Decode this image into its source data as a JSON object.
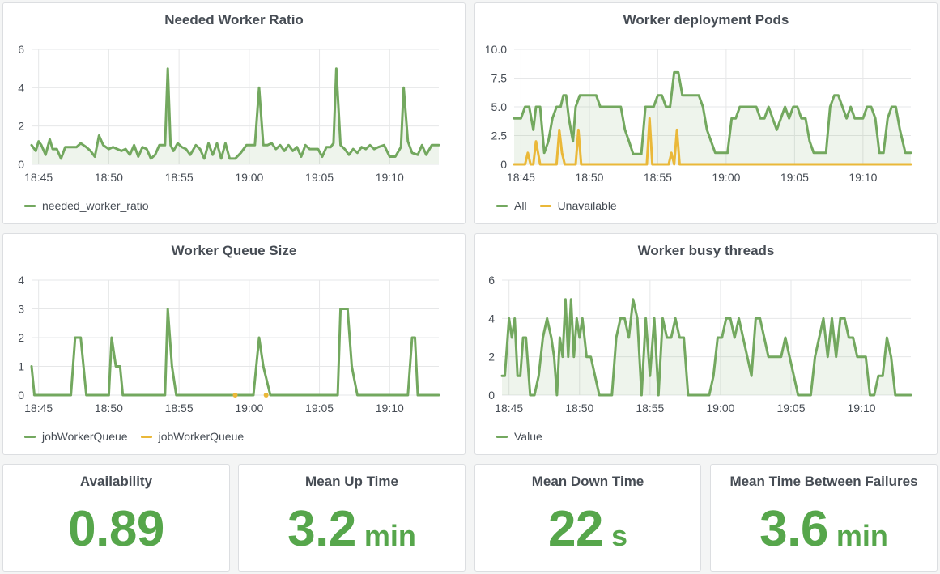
{
  "colors": {
    "green": "#73a85f",
    "green_fill": "rgba(115,168,95,0.12)",
    "yellow": "#eab839",
    "stat_green": "#56a64b",
    "grid": "#e6e7e8",
    "axis_text": "#464c54"
  },
  "panels": {
    "needed_ratio": {
      "title": "Needed Worker Ratio"
    },
    "deploy_pods": {
      "title": "Worker deployment Pods"
    },
    "queue_size": {
      "title": "Worker Queue Size"
    },
    "busy_threads": {
      "title": "Worker busy threads"
    }
  },
  "stats": [
    {
      "title": "Availability",
      "value": "0.89",
      "unit": ""
    },
    {
      "title": "Mean Up Time",
      "value": "3.2",
      "unit": "min"
    },
    {
      "title": "Mean Down Time",
      "value": "22",
      "unit": "s"
    },
    {
      "title": "Mean Time Between Failures",
      "value": "3.6",
      "unit": "min"
    }
  ],
  "chart_data": [
    {
      "type": "area",
      "title": "Needed Worker Ratio",
      "x_ticks": [
        "18:45",
        "18:50",
        "18:55",
        "19:00",
        "19:05",
        "19:10"
      ],
      "x_range_min": [
        -0.5,
        28.5
      ],
      "y_ticks": [
        "0",
        "2",
        "4",
        "6"
      ],
      "ylim": [
        0,
        6
      ],
      "legend_position": "bottom-left",
      "series": [
        {
          "name": "needed_worker_ratio",
          "color": "#73a85f",
          "fill": true,
          "x": [
            -0.5,
            -0.2,
            0,
            0.2,
            0.5,
            0.8,
            1,
            1.3,
            1.6,
            1.9,
            2.3,
            2.7,
            3,
            3.4,
            3.7,
            4,
            4.3,
            4.6,
            5,
            5.3,
            5.6,
            5.9,
            6.2,
            6.5,
            6.8,
            7.1,
            7.4,
            7.7,
            8,
            8.3,
            8.6,
            9,
            9.2,
            9.4,
            9.6,
            9.9,
            10.2,
            10.5,
            10.8,
            11.2,
            11.5,
            11.8,
            12.1,
            12.4,
            12.7,
            13,
            13.3,
            13.6,
            14,
            14.4,
            14.8,
            15.1,
            15.4,
            15.7,
            16,
            16.3,
            16.6,
            16.9,
            17.2,
            17.5,
            17.8,
            18.1,
            18.4,
            18.7,
            19,
            19.3,
            19.6,
            19.9,
            20.2,
            20.5,
            20.8,
            21,
            21.2,
            21.5,
            21.8,
            22.1,
            22.4,
            22.7,
            23,
            23.3,
            23.6,
            23.9,
            24.2,
            24.6,
            25,
            25.4,
            25.8,
            26,
            26.3,
            26.6,
            27,
            27.3,
            27.6,
            28,
            28.5
          ],
          "y": [
            1,
            0.7,
            1.2,
            1,
            0.5,
            1.3,
            0.8,
            0.8,
            0.3,
            0.9,
            0.9,
            0.9,
            1.1,
            0.9,
            0.7,
            0.4,
            1.5,
            1,
            0.8,
            0.9,
            0.8,
            0.7,
            0.8,
            0.5,
            1,
            0.4,
            0.9,
            0.8,
            0.3,
            0.5,
            1,
            1,
            5,
            1,
            0.7,
            1.1,
            0.9,
            0.8,
            0.5,
            1,
            0.8,
            0.3,
            1.1,
            0.5,
            1.1,
            0.3,
            1.1,
            0.3,
            0.3,
            0.6,
            1,
            1,
            1,
            4,
            1,
            1,
            1.1,
            0.8,
            1,
            0.7,
            1,
            0.7,
            0.9,
            0.4,
            1,
            0.8,
            0.8,
            0.8,
            0.4,
            0.9,
            0.9,
            1.1,
            5,
            1,
            0.8,
            0.5,
            0.8,
            0.6,
            0.9,
            0.8,
            1,
            0.8,
            0.9,
            1,
            0.4,
            0.4,
            0.9,
            4,
            1.2,
            0.6,
            0.5,
            1,
            0.5,
            1,
            1
          ]
        }
      ]
    },
    {
      "type": "area",
      "title": "Worker deployment Pods",
      "x_ticks": [
        "18:45",
        "18:50",
        "18:55",
        "19:00",
        "19:05",
        "19:10"
      ],
      "x_range_min": [
        -0.5,
        28.5
      ],
      "y_ticks": [
        "0",
        "2.5",
        "5.0",
        "7.5",
        "10.0"
      ],
      "ylim": [
        0,
        10
      ],
      "legend_position": "bottom-left",
      "series": [
        {
          "name": "All",
          "color": "#73a85f",
          "fill": true,
          "x": [
            -0.5,
            0,
            0.3,
            0.6,
            0.9,
            1.1,
            1.4,
            1.7,
            2,
            2.3,
            2.6,
            2.9,
            3.1,
            3.3,
            3.5,
            3.8,
            4,
            4.3,
            4.6,
            4.9,
            5.2,
            5.5,
            5.8,
            6.1,
            6.4,
            6.7,
            7,
            7.3,
            7.6,
            7.9,
            8.2,
            8.5,
            8.8,
            9.1,
            9.4,
            9.7,
            10,
            10.3,
            10.6,
            10.9,
            11.2,
            11.5,
            11.8,
            12.1,
            12.4,
            12.7,
            13,
            13.3,
            13.6,
            13.9,
            14.2,
            14.5,
            14.8,
            15.1,
            15.4,
            15.7,
            16,
            16.3,
            16.6,
            16.9,
            17.2,
            17.5,
            17.8,
            18.1,
            18.4,
            18.7,
            19,
            19.3,
            19.6,
            19.9,
            20.2,
            20.5,
            20.8,
            21.1,
            21.4,
            21.7,
            22,
            22.3,
            22.6,
            22.9,
            23.2,
            23.5,
            23.8,
            24.1,
            24.4,
            24.7,
            25,
            25.3,
            25.6,
            25.9,
            26.2,
            26.5,
            26.8,
            27.1,
            27.4,
            27.7,
            28.1,
            28.5
          ],
          "y": [
            4,
            4,
            5,
            5,
            3,
            5,
            5,
            1,
            2,
            4,
            5,
            5,
            6,
            6,
            4,
            2,
            5,
            6,
            6,
            6,
            6,
            6,
            5,
            5,
            5,
            5,
            5,
            5,
            3,
            2,
            0.9,
            0.9,
            0.9,
            5,
            5,
            5,
            6,
            6,
            5,
            5,
            8,
            8,
            6,
            6,
            6,
            6,
            6,
            5,
            3,
            2,
            1,
            1,
            1,
            1,
            4,
            4,
            5,
            5,
            5,
            5,
            5,
            4,
            4,
            5,
            4,
            3,
            4,
            5,
            4,
            5,
            5,
            4,
            4,
            2,
            1,
            1,
            1,
            1,
            5,
            6,
            6,
            5,
            4,
            5,
            4,
            4,
            4,
            5,
            5,
            4,
            1,
            1,
            4,
            5,
            5,
            3,
            1,
            1
          ],
          "smooth_hint": ""
        },
        {
          "name": "Unavailable",
          "color": "#eab839",
          "fill": false,
          "x": [
            -0.5,
            0.3,
            0.5,
            0.7,
            0.9,
            1.1,
            1.4,
            1.7,
            2,
            2.2,
            2.4,
            2.6,
            2.8,
            3,
            3.2,
            3.4,
            3.6,
            3.8,
            4,
            4.2,
            4.4,
            9.2,
            9.4,
            9.6,
            9.8,
            10,
            10.8,
            11,
            11.2,
            11.4,
            11.6,
            28.5
          ],
          "y": [
            0,
            0,
            1,
            0,
            0,
            2,
            0,
            0,
            0,
            0,
            0,
            0,
            3,
            1,
            0,
            0,
            0,
            0,
            0,
            3,
            0,
            0,
            4,
            0,
            0,
            0,
            0,
            1,
            0,
            3,
            0,
            0
          ]
        }
      ]
    },
    {
      "type": "line",
      "title": "Worker Queue Size",
      "x_ticks": [
        "18:45",
        "18:50",
        "18:55",
        "19:00",
        "19:05",
        "19:10"
      ],
      "x_range_min": [
        -0.5,
        28.5
      ],
      "y_ticks": [
        "0",
        "1",
        "2",
        "3",
        "4"
      ],
      "ylim": [
        0,
        4
      ],
      "legend_position": "bottom-left",
      "series": [
        {
          "name": "jobWorkerQueue",
          "color": "#73a85f",
          "fill": false,
          "x": [
            -0.5,
            -0.3,
            0,
            0.5,
            1,
            1.5,
            2,
            2.3,
            2.6,
            3,
            3.4,
            3.7,
            4,
            4.5,
            4.8,
            5,
            5.2,
            5.5,
            5.8,
            6,
            6.3,
            6.6,
            7,
            7.5,
            8,
            8.5,
            9,
            9.2,
            9.5,
            9.8,
            10,
            11,
            12,
            13,
            14,
            14.5,
            15,
            15.3,
            15.7,
            16,
            16.5,
            17,
            18,
            19,
            20,
            21,
            21.3,
            21.5,
            21.7,
            22,
            22.3,
            22.7,
            23,
            24,
            25,
            25.5,
            26,
            26.3,
            26.6,
            26.8,
            27,
            27.2,
            27.5,
            28,
            28.5
          ],
          "y": [
            1,
            0,
            0,
            0,
            0,
            0,
            0,
            0,
            2,
            2,
            0,
            0,
            0,
            0,
            0,
            0,
            2,
            1,
            1,
            0,
            0,
            0,
            0,
            0,
            0,
            0,
            0,
            3,
            1,
            0,
            0,
            0,
            0,
            0,
            0,
            0,
            0,
            0,
            2,
            1,
            0,
            0,
            0,
            0,
            0,
            0,
            0,
            3,
            3,
            3,
            1,
            0,
            0,
            0,
            0,
            0,
            0,
            0,
            2,
            2,
            0,
            0,
            0,
            0,
            0
          ]
        },
        {
          "name": "jobWorkerQueue",
          "color": "#eab839",
          "fill": false,
          "points_only": true,
          "x": [
            14,
            16.2
          ],
          "y": [
            0,
            0
          ]
        }
      ]
    },
    {
      "type": "area",
      "title": "Worker busy threads",
      "x_ticks": [
        "18:45",
        "18:50",
        "18:55",
        "19:00",
        "19:05",
        "19:10"
      ],
      "x_range_min": [
        -0.5,
        28.5
      ],
      "y_ticks": [
        "0",
        "2",
        "4",
        "6"
      ],
      "ylim": [
        0,
        6
      ],
      "legend_position": "bottom-left",
      "series": [
        {
          "name": "Value",
          "color": "#73a85f",
          "fill": true,
          "x": [
            -0.5,
            -0.3,
            0,
            0.2,
            0.4,
            0.6,
            0.8,
            1,
            1.2,
            1.5,
            1.8,
            2.1,
            2.4,
            2.7,
            3,
            3.2,
            3.4,
            3.6,
            3.8,
            4,
            4.2,
            4.4,
            4.6,
            4.8,
            5,
            5.2,
            5.5,
            5.8,
            6.1,
            6.4,
            6.7,
            7,
            7.3,
            7.6,
            7.9,
            8.2,
            8.5,
            8.8,
            9.1,
            9.4,
            9.7,
            10,
            10.3,
            10.6,
            10.9,
            11.2,
            11.5,
            11.8,
            12.1,
            12.4,
            12.7,
            13,
            13.3,
            13.6,
            13.9,
            14.2,
            14.5,
            14.8,
            15.1,
            15.4,
            15.7,
            16,
            16.3,
            16.6,
            16.9,
            17.2,
            17.5,
            17.8,
            18.1,
            18.4,
            18.7,
            19,
            19.3,
            19.6,
            19.9,
            20.2,
            20.5,
            20.8,
            21.1,
            21.4,
            21.7,
            22,
            22.3,
            22.6,
            22.9,
            23.2,
            23.5,
            23.8,
            24.1,
            24.4,
            24.7,
            25,
            25.3,
            25.6,
            25.9,
            26.2,
            26.5,
            26.8,
            27.1,
            27.4,
            27.7,
            28,
            28.5
          ],
          "y": [
            1,
            1,
            4,
            3,
            4,
            1,
            1,
            3,
            3,
            0,
            0,
            1,
            3,
            4,
            3,
            2,
            0,
            3,
            2,
            5,
            2,
            5,
            2,
            4,
            3,
            4,
            2,
            2,
            1,
            0,
            0,
            0,
            0,
            3,
            4,
            4,
            3,
            5,
            4,
            0,
            4,
            1,
            4,
            0,
            4,
            3,
            3,
            4,
            3,
            3,
            0,
            0,
            0,
            0,
            0,
            0,
            1,
            3,
            3,
            4,
            4,
            3,
            4,
            3,
            2,
            1,
            4,
            4,
            3,
            2,
            2,
            2,
            2,
            3,
            2,
            1,
            0,
            0,
            0,
            0,
            2,
            3,
            4,
            2,
            4,
            2,
            4,
            4,
            3,
            3,
            2,
            2,
            2,
            0,
            0,
            1,
            1,
            3,
            2,
            0,
            0,
            0,
            0
          ]
        }
      ]
    }
  ]
}
